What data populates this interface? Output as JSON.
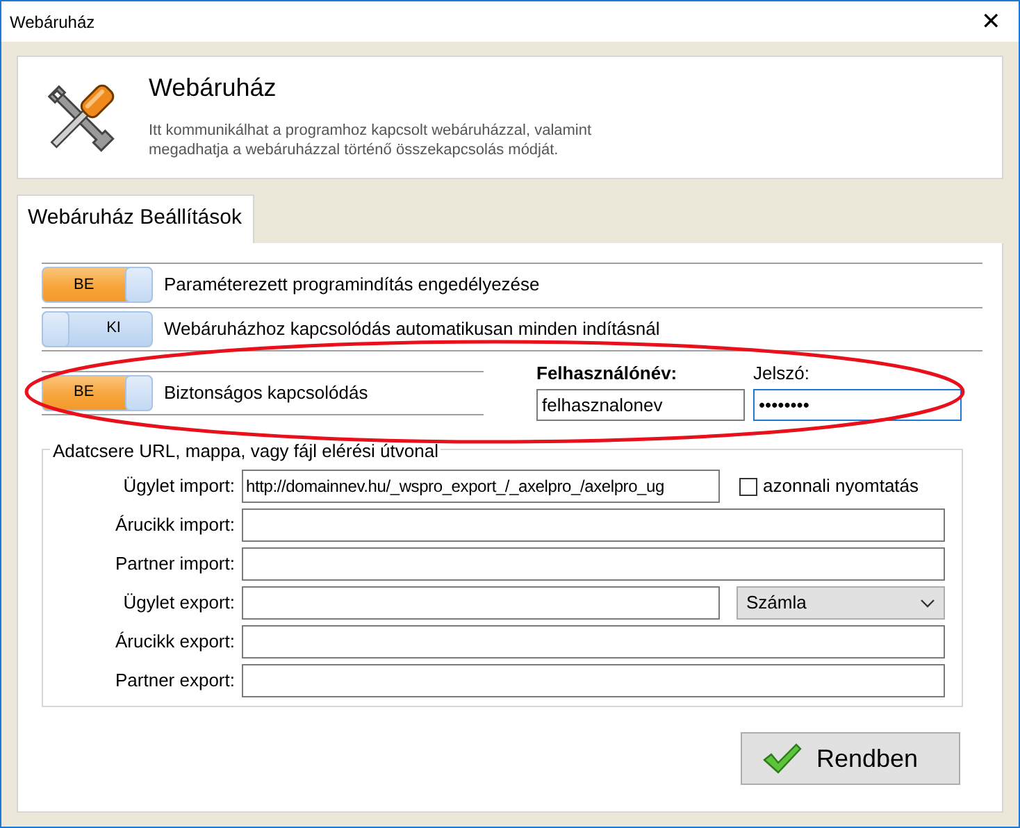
{
  "window": {
    "title": "Webáruház",
    "close": "✕"
  },
  "header": {
    "title": "Webáruház",
    "description": "Itt kommunikálhat a programhoz kapcsolt webáruházzal, valamint megadhatja a webáruházzal történő összekapcsolás módját."
  },
  "tabs": [
    {
      "label": "Webáruház Beállítások",
      "selected": true
    }
  ],
  "toggles": [
    {
      "label": "Paraméterezett programindítás engedélyezése",
      "on": true,
      "toggle_text": "BE"
    },
    {
      "label": "Webáruházhoz kapcsolódás automatikusan minden indításnál",
      "on": false,
      "toggle_text": "KI"
    },
    {
      "label": "Biztonságos kapcsolódás",
      "on": true,
      "toggle_text": "BE"
    }
  ],
  "credentials": {
    "username_label": "Felhasználónév:",
    "username": "felhasznalonev",
    "password_label": "Jelszó:",
    "password": "••••••••",
    "password_focused": true
  },
  "annotation": {
    "kind": "ellipse",
    "color": "#e8101a"
  },
  "exchange": {
    "legend": "Adatcsere URL, mappa, vagy fájl elérési útvonal",
    "rows": [
      {
        "kind": "checkbox",
        "label": "Ügylet import:",
        "value": "http://domainnev.hu/_wspro_export_/_axelpro_/axelpro_ug",
        "option": "azonnali nyomtatás",
        "checked": false
      },
      {
        "kind": "plain",
        "label": "Árucikk import:"
      },
      {
        "kind": "plain",
        "label": "Partner import:"
      },
      {
        "kind": "select",
        "label": "Ügylet export:",
        "option": "Számla"
      },
      {
        "kind": "plain",
        "label": "Árucikk export:"
      },
      {
        "kind": "plain",
        "label": "Partner export:"
      }
    ]
  },
  "ok_button": {
    "label": "Rendben"
  }
}
